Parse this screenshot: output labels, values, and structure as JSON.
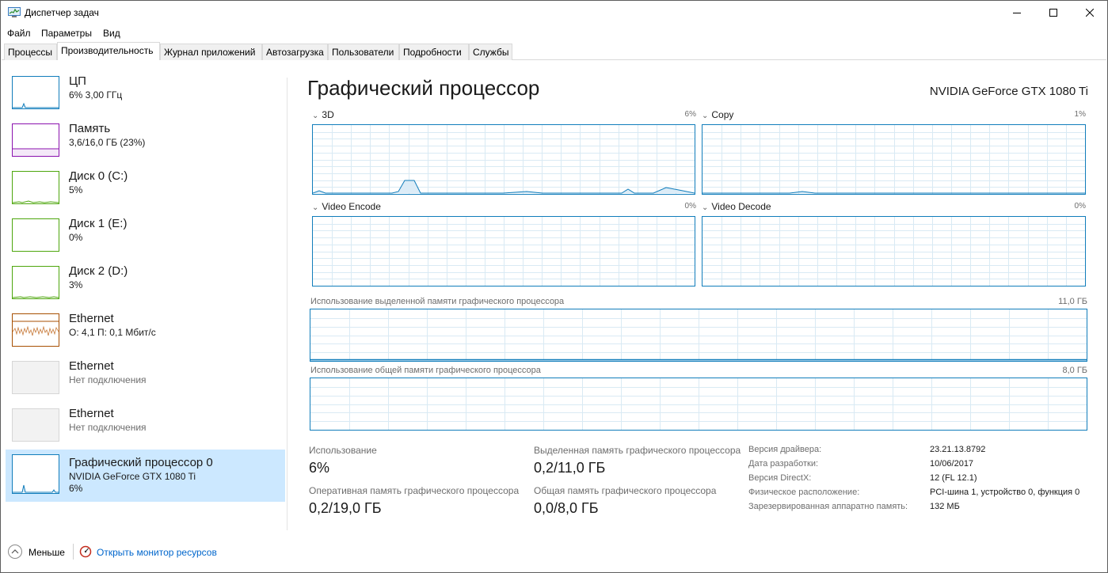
{
  "window": {
    "title": "Диспетчер задач"
  },
  "menu": [
    "Файл",
    "Параметры",
    "Вид"
  ],
  "tabs": [
    "Процессы",
    "Производительность",
    "Журнал приложений",
    "Автозагрузка",
    "Пользователи",
    "Подробности",
    "Службы"
  ],
  "active_tab": "Производительность",
  "sidebar": [
    {
      "name": "ЦП",
      "sub": "6% 3,00 ГГц",
      "color": "#117dbb"
    },
    {
      "name": "Память",
      "sub": "3,6/16,0 ГБ (23%)",
      "color": "#8b12ae"
    },
    {
      "name": "Диск 0 (C:)",
      "sub": "5%",
      "color": "#4da60c"
    },
    {
      "name": "Диск 1 (E:)",
      "sub": "0%",
      "color": "#4da60c"
    },
    {
      "name": "Диск 2 (D:)",
      "sub": "3%",
      "color": "#4da60c"
    },
    {
      "name": "Ethernet",
      "sub": "О: 4,1 П: 0,1 Мбит/с",
      "color": "#a74f01"
    },
    {
      "name": "Ethernet",
      "sub": "Нет подключения",
      "color": "#d6d6d6"
    },
    {
      "name": "Ethernet",
      "sub": "Нет подключения",
      "color": "#d6d6d6"
    },
    {
      "name": "Графический процессор 0",
      "sub": "NVIDIA GeForce GTX 1080 Ti",
      "sub2": "6%",
      "color": "#117dbb"
    }
  ],
  "gpu": {
    "title": "Графический процессор",
    "model": "NVIDIA GeForce GTX 1080 Ti",
    "engines": [
      {
        "name": "3D",
        "percent": "6%"
      },
      {
        "name": "Copy",
        "percent": "1%"
      },
      {
        "name": "Video Encode",
        "percent": "0%"
      },
      {
        "name": "Video Decode",
        "percent": "0%"
      }
    ],
    "dedicated_mem_label": "Использование выделенной памяти графического процессора",
    "dedicated_mem_max": "11,0 ГБ",
    "shared_mem_label": "Использование общей памяти графического процессора",
    "shared_mem_max": "8,0 ГБ",
    "stats": {
      "utilization_label": "Использование",
      "utilization_value": "6%",
      "dedicated_label": "Выделенная память графического процессора",
      "dedicated_value": "0,2/11,0 ГБ",
      "ram_label": "Оперативная память графического процессора",
      "ram_value": "0,2/19,0 ГБ",
      "shared_label": "Общая память графического процессора",
      "shared_value": "0,0/8,0 ГБ"
    },
    "info": [
      {
        "key": "Версия драйвера:",
        "value": "23.21.13.8792"
      },
      {
        "key": "Дата разработки:",
        "value": "10/06/2017"
      },
      {
        "key": "Версия DirectX:",
        "value": "12 (FL 12.1)"
      },
      {
        "key": "Физическое расположение:",
        "value": "PCI-шина 1, устройство 0, функция 0"
      },
      {
        "key": "Зарезервированная аппаратно память:",
        "value": "132 МБ"
      }
    ]
  },
  "footer": {
    "fewer": "Меньше",
    "resource_monitor": "Открыть монитор ресурсов"
  },
  "graph_color": "#117dbb",
  "grid_color": "#d9eaf4"
}
